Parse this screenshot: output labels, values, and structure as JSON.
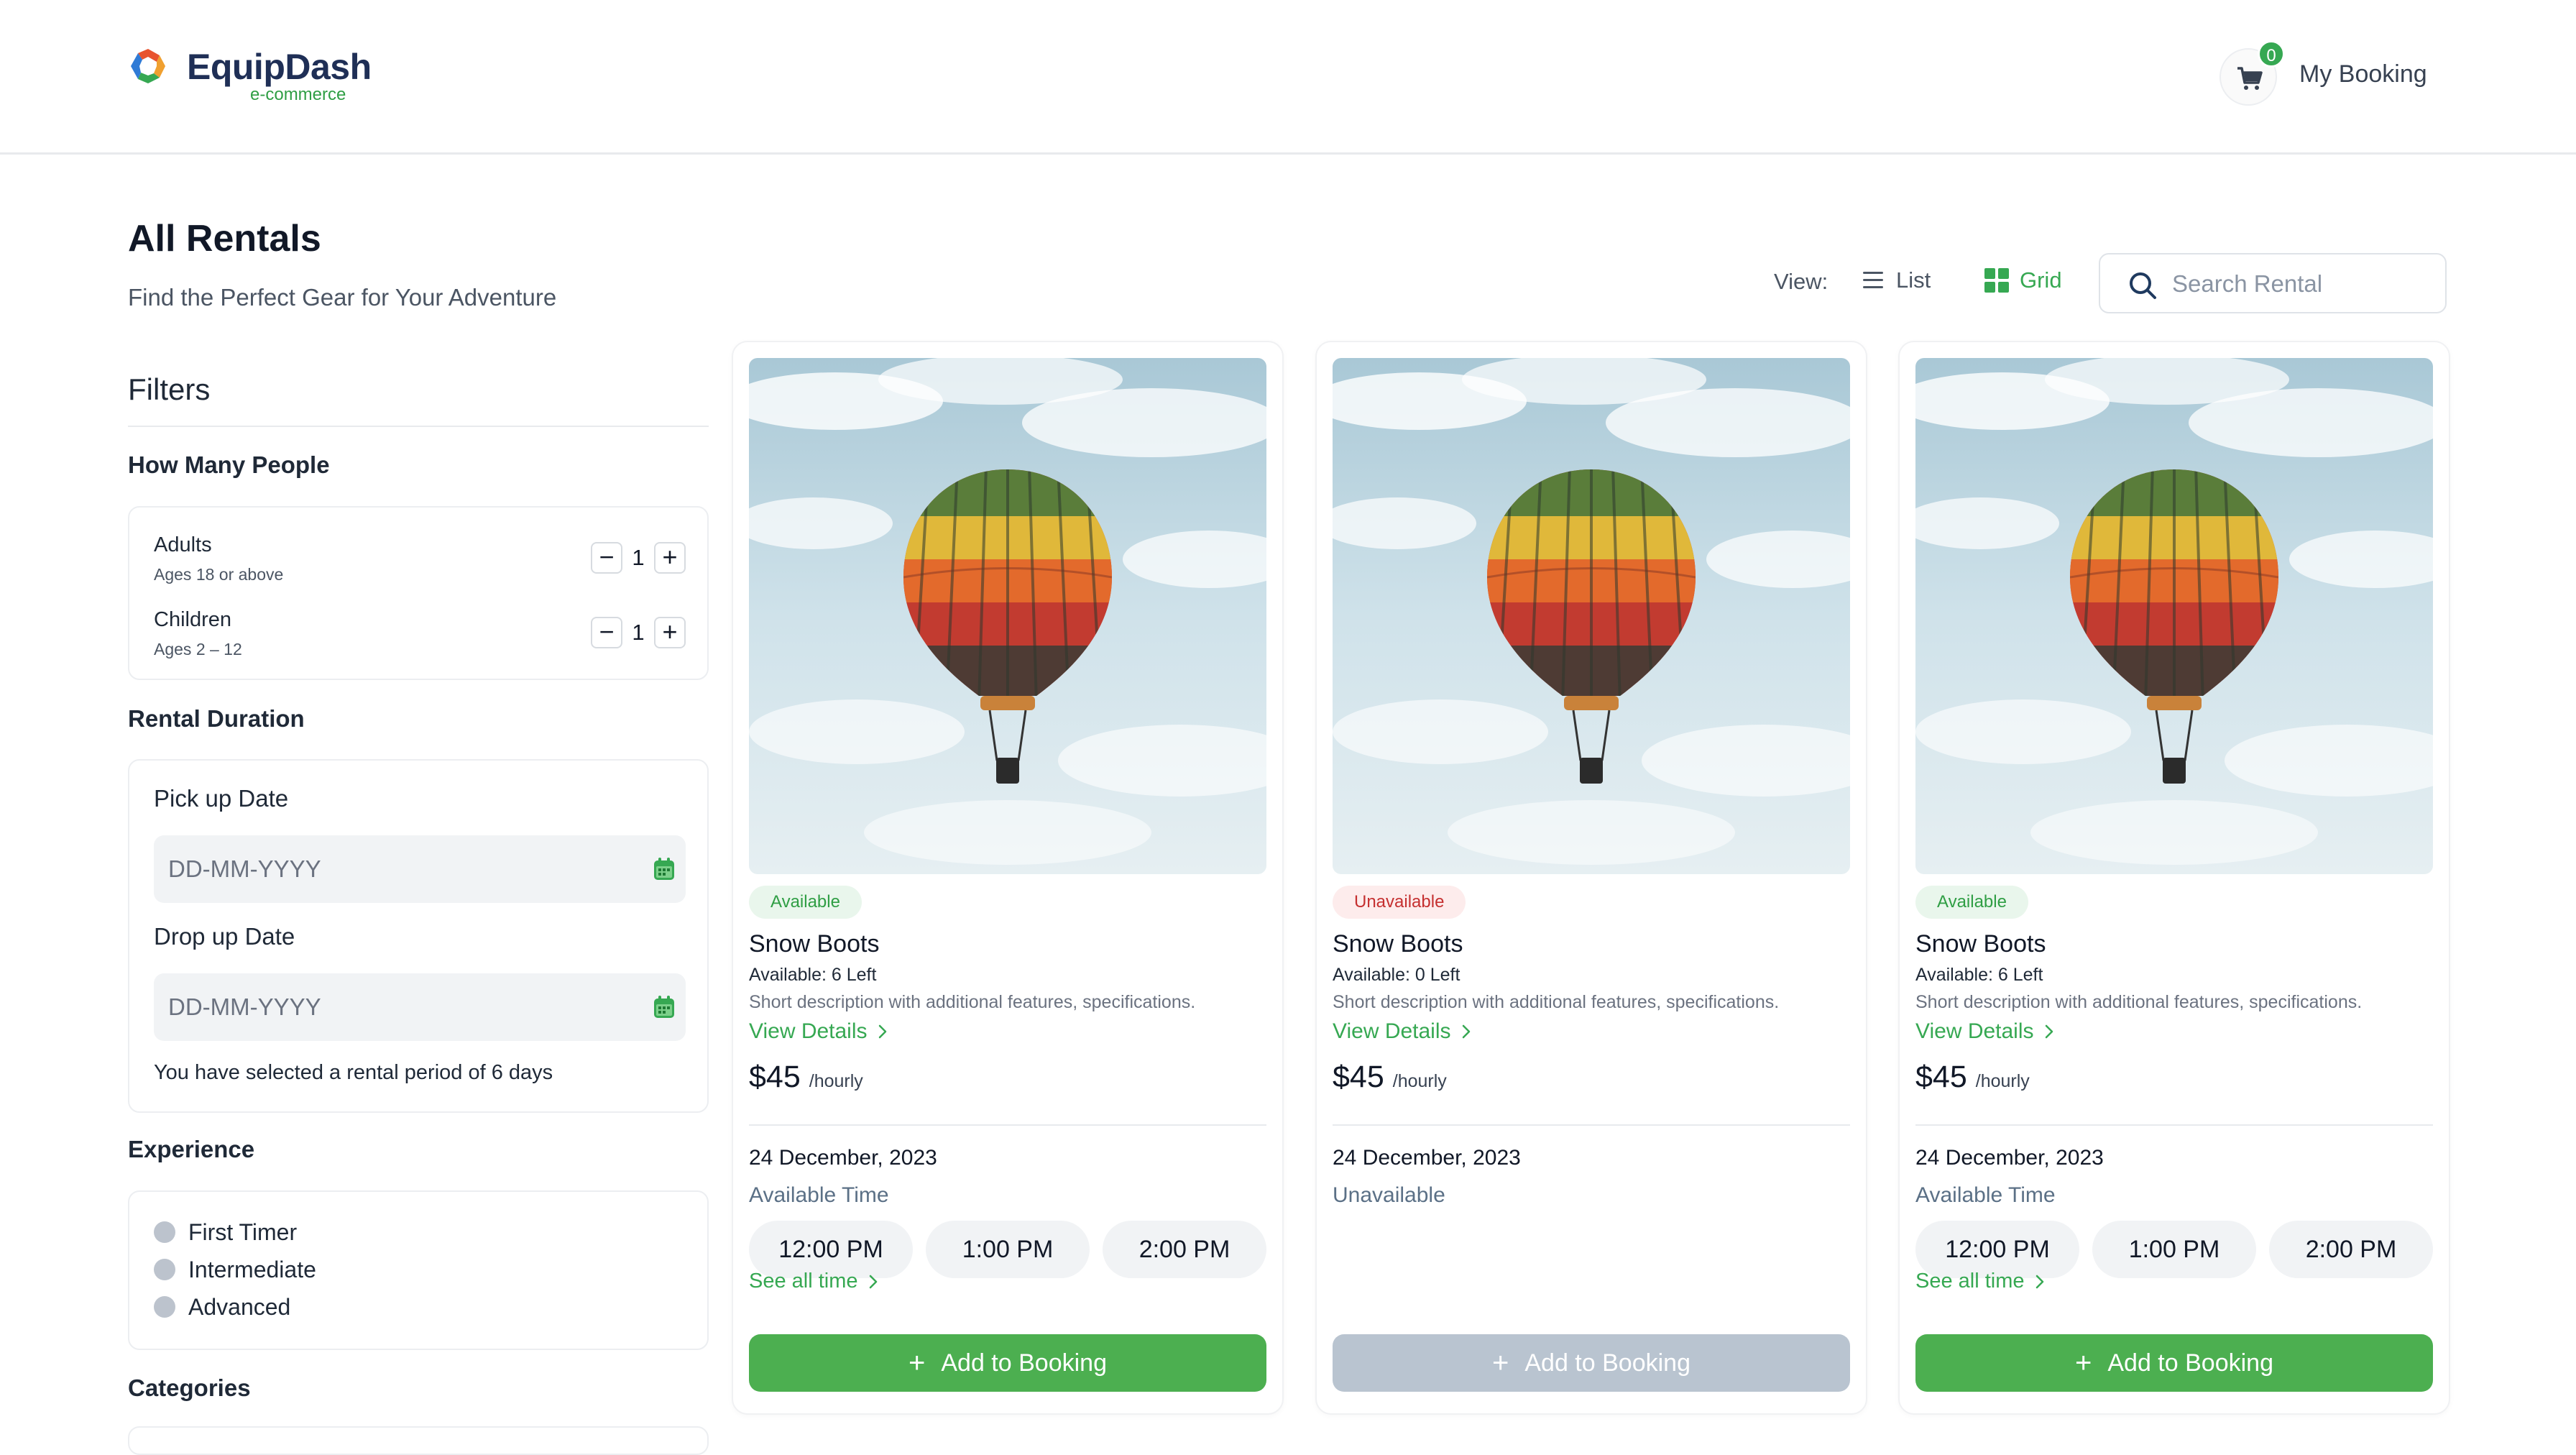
{
  "header": {
    "brand": "EquipDash",
    "brand_sub": "e-commerce",
    "cart_count": "0",
    "my_booking": "My Booking"
  },
  "page": {
    "title": "All Rentals",
    "subtitle": "Find the Perfect Gear for Your Adventure"
  },
  "toolbar": {
    "view_label": "View:",
    "list_label": "List",
    "grid_label": "Grid",
    "active_view": "grid",
    "search_placeholder": "Search Rental",
    "search_value": ""
  },
  "filters": {
    "title": "Filters",
    "people": {
      "title": "How Many People",
      "adults_label": "Adults",
      "adults_sub": "Ages 18 or above",
      "adults_value": "1",
      "children_label": "Children",
      "children_sub": "Ages 2 – 12",
      "children_value": "1"
    },
    "duration": {
      "title": "Rental Duration",
      "pickup_label": "Pick up Date",
      "pickup_placeholder": "DD-MM-YYYY",
      "dropoff_label": "Drop up Date",
      "dropoff_placeholder": "DD-MM-YYYY",
      "note": "You have selected a rental period of 6 days"
    },
    "experience": {
      "title": "Experience",
      "options": [
        "First Timer",
        "Intermediate",
        "Advanced"
      ]
    },
    "categories_title": "Categories"
  },
  "products": [
    {
      "status": "Available",
      "status_type": "available",
      "name": "Snow Boots",
      "availability": "Available: 6 Left",
      "description": "Short description with additional features, specifications.",
      "details_link": "View Details",
      "price": "$45",
      "price_unit": "/hourly",
      "date": "24 December, 2023",
      "time_label": "Available Time",
      "slots": [
        "12:00 PM",
        "1:00 PM",
        "2:00 PM"
      ],
      "see_all": "See all time",
      "button": "Add to Booking"
    },
    {
      "status": "Unavailable",
      "status_type": "unavailable",
      "name": "Snow Boots",
      "availability": "Available: 0 Left",
      "description": "Short description with additional features, specifications.",
      "details_link": "View Details",
      "price": "$45",
      "price_unit": "/hourly",
      "date": "24 December, 2023",
      "time_label": "Unavailable",
      "slots": [],
      "see_all": "",
      "button": "Add to Booking"
    },
    {
      "status": "Available",
      "status_type": "available",
      "name": "Snow Boots",
      "availability": "Available: 6 Left",
      "description": "Short description with additional features, specifications.",
      "details_link": "View Details",
      "price": "$45",
      "price_unit": "/hourly",
      "date": "24 December, 2023",
      "time_label": "Available Time",
      "slots": [
        "12:00 PM",
        "1:00 PM",
        "2:00 PM"
      ],
      "see_all": "See all time",
      "button": "Add to Booking"
    }
  ],
  "colors": {
    "accent": "#36a852",
    "button_enabled": "#4caf50",
    "button_disabled": "#b9c4d0",
    "brand_text": "#1f2f56",
    "unavailable": "#c53030"
  },
  "icons": {
    "cart": "shopping-cart-icon",
    "list": "list-icon",
    "grid": "grid-icon",
    "search": "search-icon",
    "calendar": "calendar-icon",
    "chevron": "chevron-right-icon",
    "plus": "plus-icon",
    "product_image": "hot-air-balloon-photo"
  }
}
